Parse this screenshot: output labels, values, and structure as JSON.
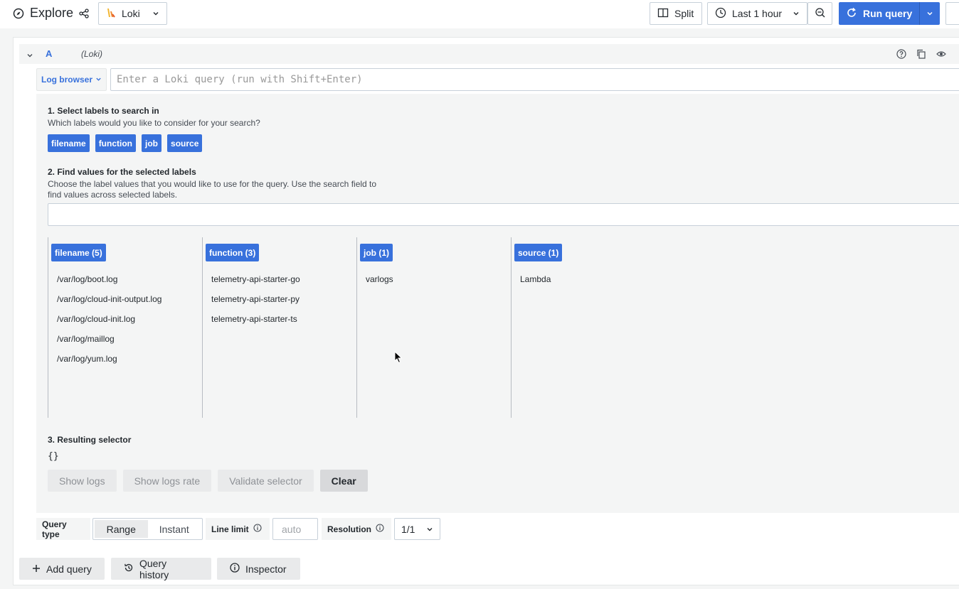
{
  "header": {
    "title": "Explore",
    "datasource": "Loki",
    "split_label": "Split",
    "time_range": "Last 1 hour",
    "run_label": "Run query"
  },
  "query_row": {
    "ref_id": "A",
    "datasource_name": "(Loki)"
  },
  "editor": {
    "log_browser_label": "Log browser",
    "query_placeholder": "Enter a Loki query (run with Shift+Enter)"
  },
  "browser": {
    "step1_title": "1. Select labels to search in",
    "step1_desc": "Which labels would you like to consider for your search?",
    "labels": [
      "filename",
      "function",
      "job",
      "source"
    ],
    "step2_title": "2. Find values for the selected labels",
    "step2_desc_line1": "Choose the label values that you would like to use for the query. Use the search field to",
    "step2_desc_line2": "find values across selected labels.",
    "columns": [
      {
        "head": "filename (5)",
        "values": [
          "/var/log/boot.log",
          "/var/log/cloud-init-output.log",
          "/var/log/cloud-init.log",
          "/var/log/maillog",
          "/var/log/yum.log"
        ]
      },
      {
        "head": "function (3)",
        "values": [
          "telemetry-api-starter-go",
          "telemetry-api-starter-py",
          "telemetry-api-starter-ts"
        ]
      },
      {
        "head": "job (1)",
        "values": [
          "varlogs"
        ]
      },
      {
        "head": "source (1)",
        "values": [
          "Lambda"
        ]
      }
    ],
    "step3_title": "3. Resulting selector",
    "selector": "{}",
    "buttons": {
      "show_logs": "Show logs",
      "show_logs_rate": "Show logs rate",
      "validate": "Validate selector",
      "clear": "Clear"
    }
  },
  "options": {
    "query_type_label": "Query type",
    "range": "Range",
    "instant": "Instant",
    "line_limit_label": "Line limit",
    "line_limit_placeholder": "auto",
    "resolution_label": "Resolution",
    "resolution_value": "1/1"
  },
  "footer": {
    "add_query": "Add query",
    "query_history": "Query history",
    "inspector": "Inspector"
  },
  "colors": {
    "primary": "#3871dc",
    "background": "#f4f5f5"
  }
}
